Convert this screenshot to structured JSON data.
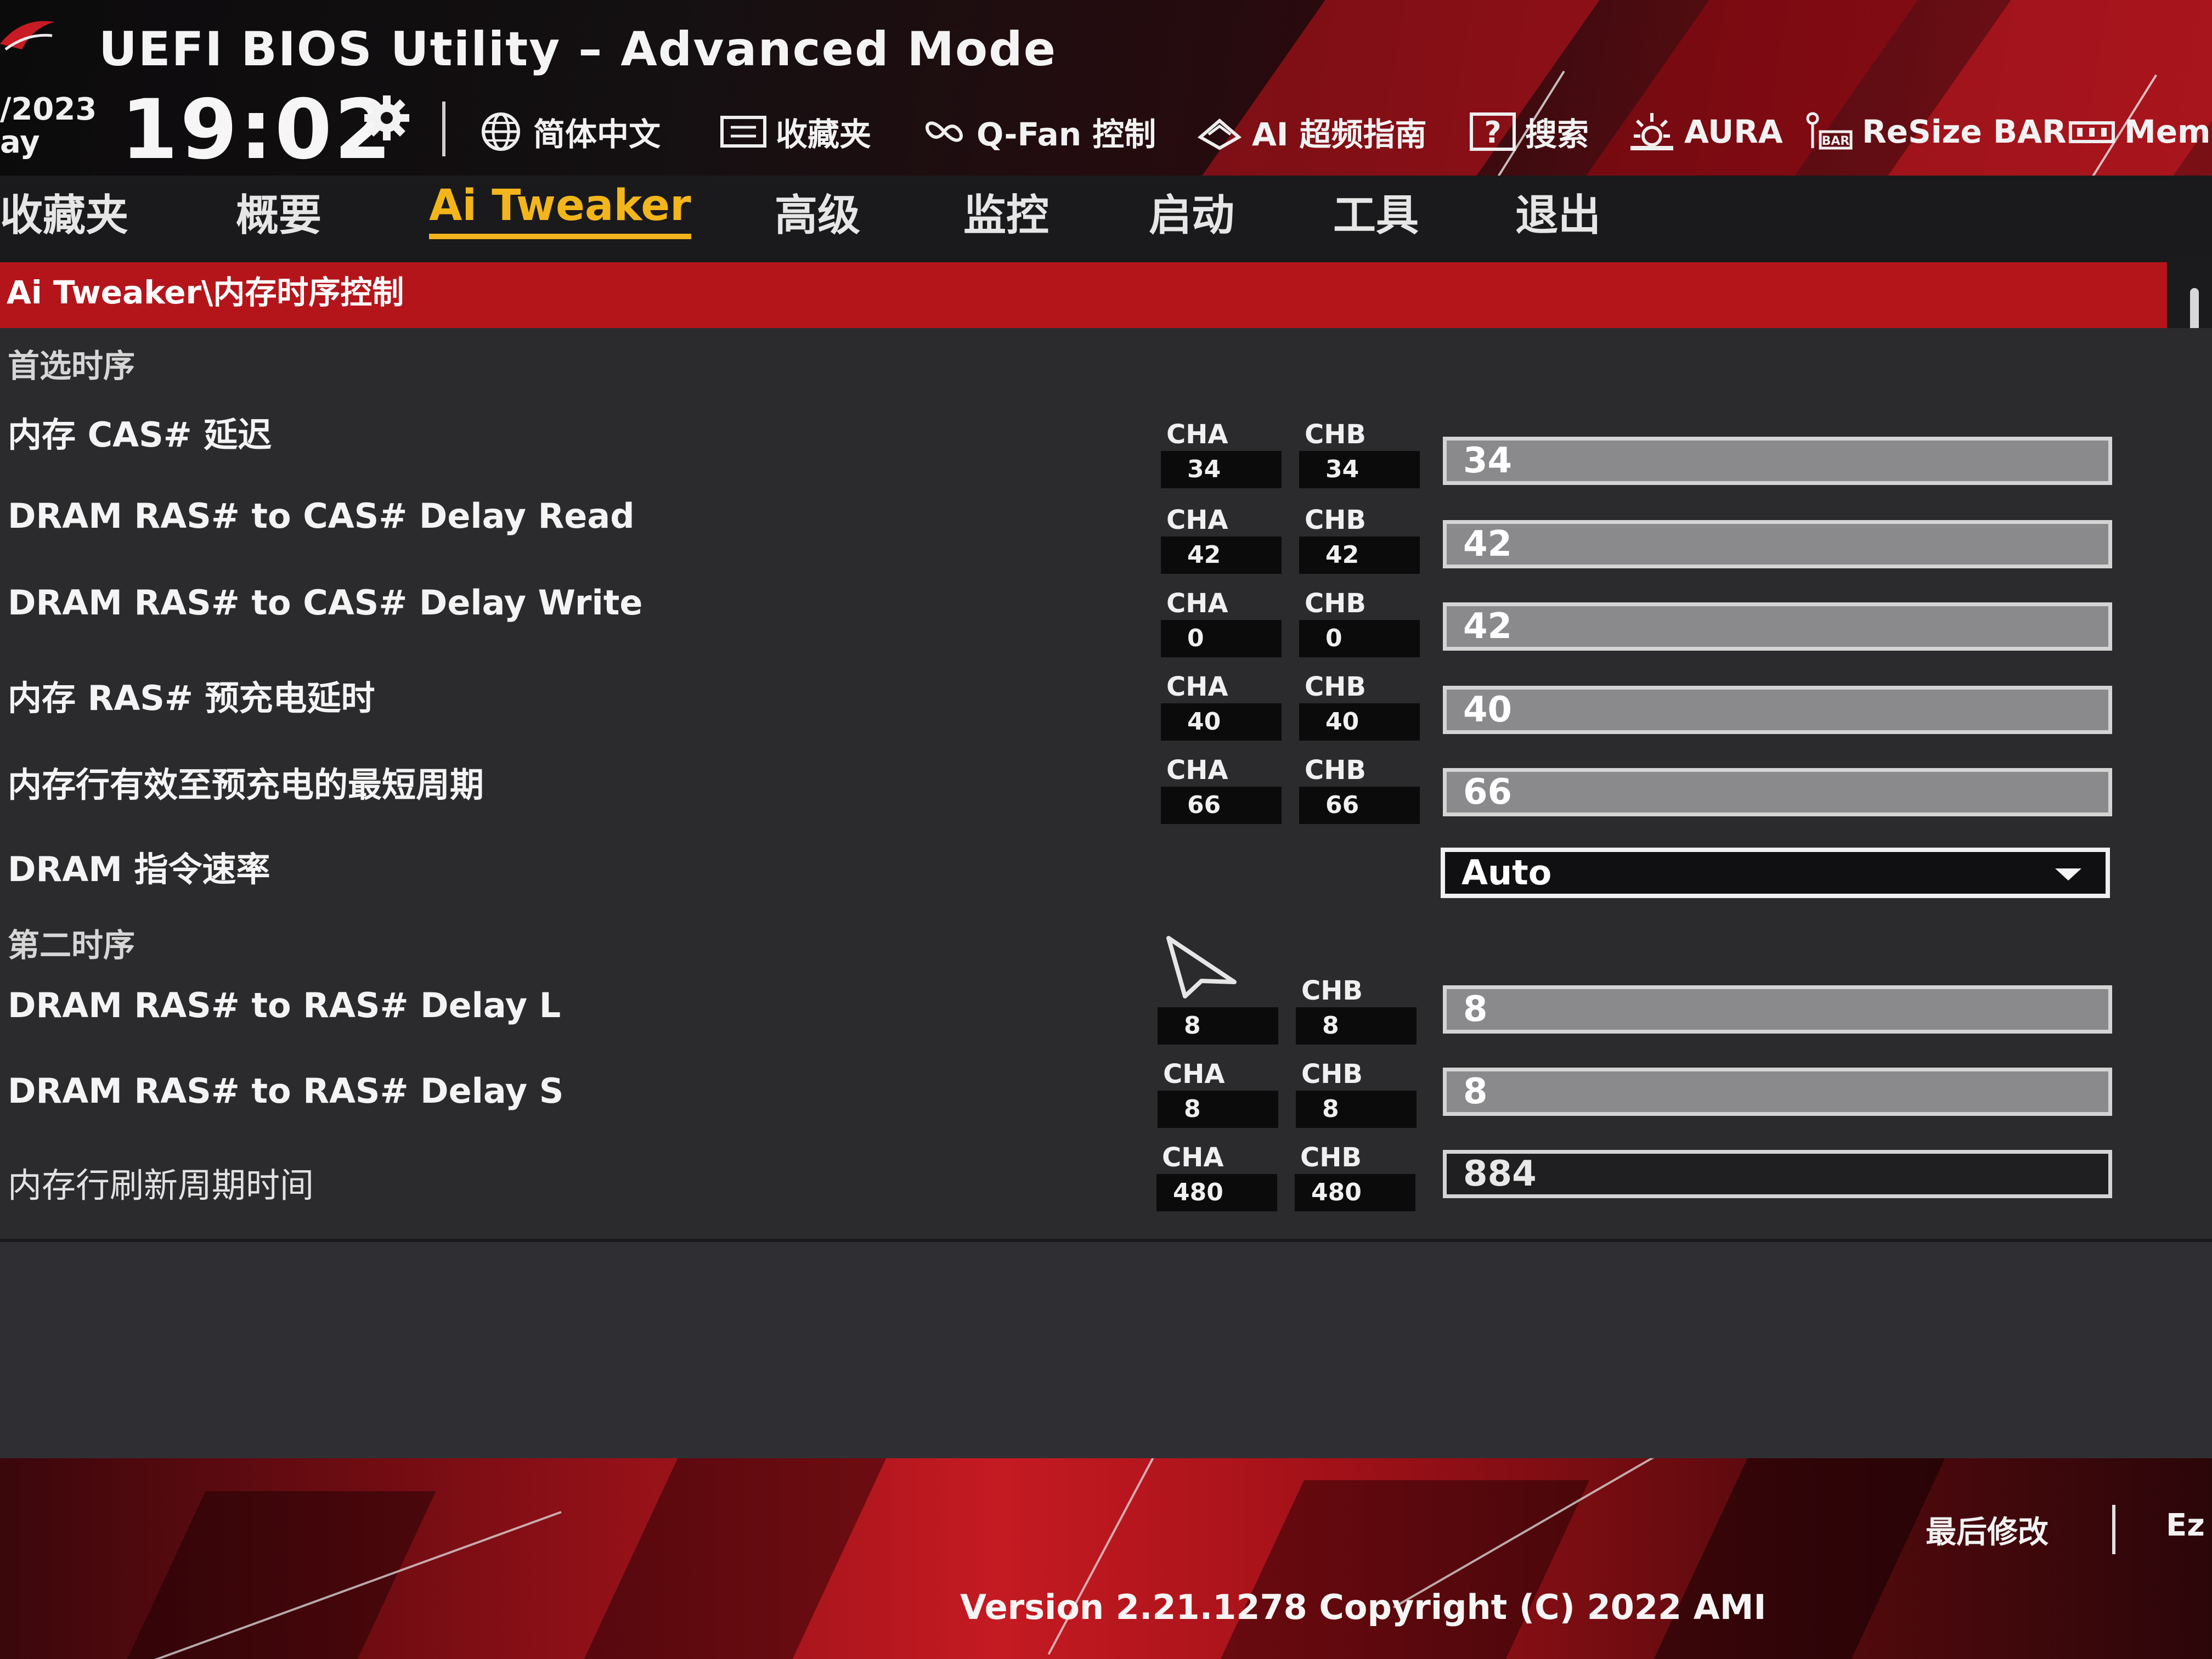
{
  "header": {
    "title": "UEFI BIOS Utility – Advanced Mode",
    "date_line1": "/2023",
    "date_line2": "ay",
    "time": "19:02",
    "tools": [
      {
        "label": "简体中文",
        "icon": "globe-icon"
      },
      {
        "label": "收藏夹",
        "icon": "favorites-icon"
      },
      {
        "label": "Q-Fan 控制",
        "icon": "fan-icon"
      },
      {
        "label": "AI 超频指南",
        "icon": "ai-overclock-icon"
      },
      {
        "label": "搜索",
        "icon": "help-search-icon"
      },
      {
        "label": "AURA",
        "icon": "aura-icon"
      },
      {
        "label": "ReSize BAR",
        "icon": "resize-bar-icon"
      },
      {
        "label": "Mem",
        "icon": "memtest-icon"
      }
    ]
  },
  "nav": {
    "tabs": [
      {
        "label": "收藏夹",
        "active": false
      },
      {
        "label": "概要",
        "active": false
      },
      {
        "label": "Ai Tweaker",
        "active": true
      },
      {
        "label": "高级",
        "active": false
      },
      {
        "label": "监控",
        "active": false
      },
      {
        "label": "启动",
        "active": false
      },
      {
        "label": "工具",
        "active": false
      },
      {
        "label": "退出",
        "active": false
      }
    ]
  },
  "breadcrumb": "Ai Tweaker\\内存时序控制",
  "sections": {
    "primary": "首选时序",
    "secondary": "第二时序"
  },
  "rows": [
    {
      "label": "内存 CAS# 延迟",
      "cha_label": "CHA",
      "cha": "34",
      "chb_label": "CHB",
      "chb": "34",
      "value": "34"
    },
    {
      "label": "DRAM RAS# to CAS# Delay Read",
      "cha_label": "CHA",
      "cha": "42",
      "chb_label": "CHB",
      "chb": "42",
      "value": "42"
    },
    {
      "label": "DRAM RAS# to CAS# Delay Write",
      "cha_label": "CHA",
      "cha": "0",
      "chb_label": "CHB",
      "chb": "0",
      "value": "42"
    },
    {
      "label": "内存 RAS# 预充电延时",
      "cha_label": "CHA",
      "cha": "40",
      "chb_label": "CHB",
      "chb": "40",
      "value": "40"
    },
    {
      "label": "内存行有效至预充电的最短周期",
      "cha_label": "CHA",
      "cha": "66",
      "chb_label": "CHB",
      "chb": "66",
      "value": "66"
    },
    {
      "label": "DRAM 指令速率",
      "select_value": "Auto"
    },
    {
      "label": "DRAM RAS# to RAS# Delay L",
      "cha_label": "",
      "cha": "8",
      "chb_label": "CHB",
      "chb": "8",
      "value": "8"
    },
    {
      "label": "DRAM RAS# to RAS# Delay S",
      "cha_label": "CHA",
      "cha": "8",
      "chb_label": "CHB",
      "chb": "8",
      "value": "8"
    },
    {
      "label": "内存行刷新周期时间",
      "cha_label": "CHA",
      "cha": "480",
      "chb_label": "CHB",
      "chb": "480",
      "value": "884"
    }
  ],
  "footer": {
    "last_modified": "最后修改",
    "ezmode": "Ez",
    "version": "Version 2.21.1278 Copyright (C) 2022 AMI"
  },
  "colors": {
    "accent_red": "#b4151b",
    "active_tab": "#f2b61c",
    "content_bg": "#2b2b2e"
  }
}
